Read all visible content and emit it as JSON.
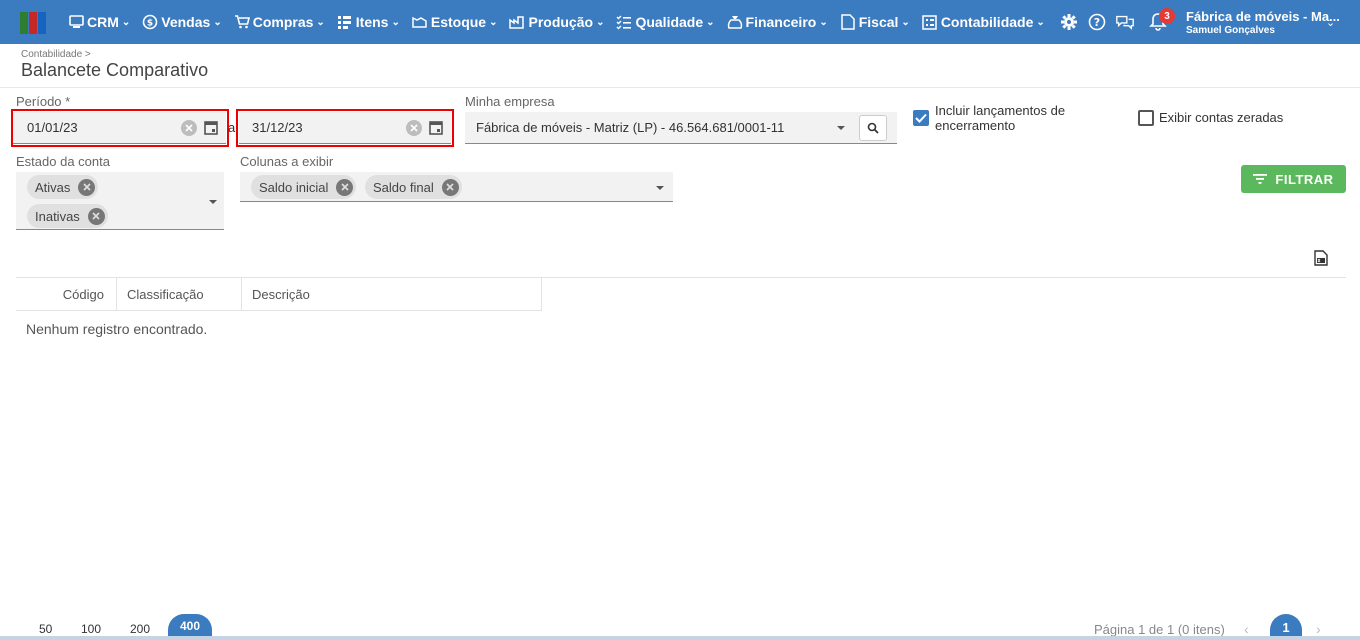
{
  "nav": {
    "items": [
      {
        "label": "CRM",
        "icon": "crm-icon"
      },
      {
        "label": "Vendas",
        "icon": "dollar-icon"
      },
      {
        "label": "Compras",
        "icon": "cart-icon"
      },
      {
        "label": "Itens",
        "icon": "items-icon"
      },
      {
        "label": "Estoque",
        "icon": "stock-icon"
      },
      {
        "label": "Produção",
        "icon": "factory-icon"
      },
      {
        "label": "Qualidade",
        "icon": "quality-icon"
      },
      {
        "label": "Financeiro",
        "icon": "money-bag-icon"
      },
      {
        "label": "Fiscal",
        "icon": "fiscal-doc-icon"
      },
      {
        "label": "Contabilidade",
        "icon": "ledger-icon"
      }
    ]
  },
  "header": {
    "notification_count": "3",
    "company_name": "Fábrica de móveis - Ma...",
    "user_name": "Samuel Gonçalves"
  },
  "page": {
    "breadcrumb": "Contabilidade >",
    "title": "Balancete Comparativo"
  },
  "filters": {
    "period_label": "Período *",
    "date_from": "01/01/23",
    "date_separator": "a",
    "date_to": "31/12/23",
    "company_label": "Minha empresa",
    "company_value": "Fábrica de móveis - Matriz (LP) - 46.564.681/0001-11",
    "include_closing_label": "Incluir lançamentos de encerramento",
    "include_closing_checked": true,
    "show_zero_label": "Exibir contas zeradas",
    "show_zero_checked": false,
    "account_state_label": "Estado da conta",
    "account_state_chips": [
      "Ativas",
      "Inativas"
    ],
    "columns_label": "Colunas a exibir",
    "columns_chips": [
      "Saldo inicial",
      "Saldo final"
    ],
    "filter_button": "FILTRAR"
  },
  "table": {
    "headers": [
      "Código",
      "Classificação",
      "Descrição"
    ],
    "empty_message": "Nenhum registro encontrado."
  },
  "pager": {
    "sizes": [
      "50",
      "100",
      "200",
      "400"
    ],
    "active_size": "400",
    "info": "Página 1 de 1 (0 itens)",
    "current_page": "1"
  },
  "colors": {
    "topbar": "#3b7bbf",
    "accent": "#3b7bbf",
    "filter_button": "#5cb85c",
    "highlight_box": "#e00000"
  }
}
